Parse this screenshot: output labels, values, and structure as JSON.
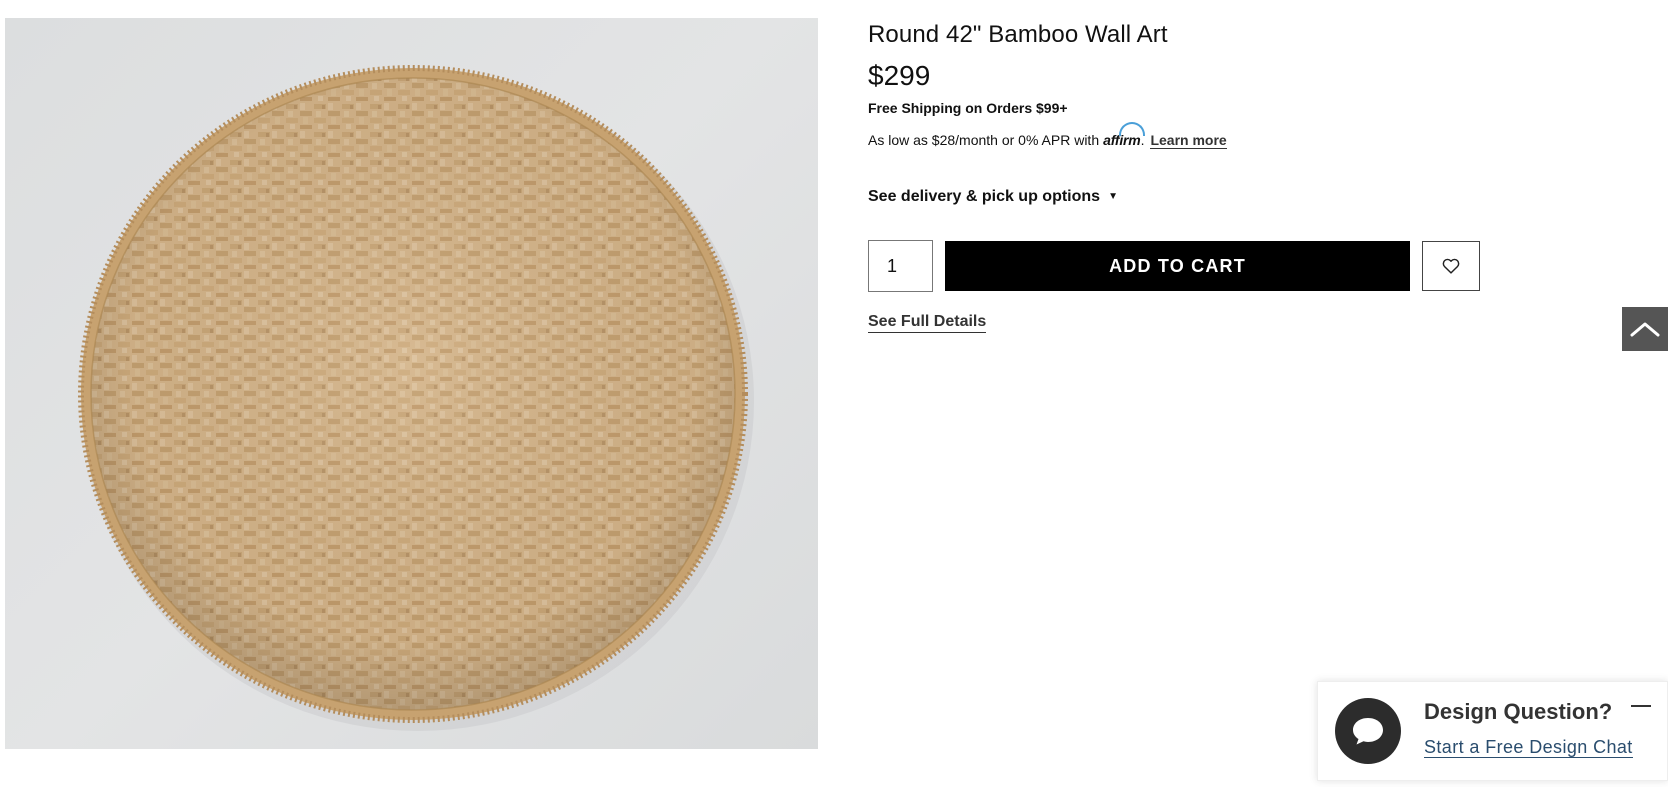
{
  "product": {
    "image_alt": "Round bamboo woven wall art",
    "title": "Round 42\" Bamboo Wall Art",
    "price": "$299",
    "shipping_note": "Free Shipping on Orders $99+",
    "financing": {
      "text": "As low as $28/month or 0% APR with",
      "provider": "affirm",
      "period": ".",
      "learn_more": "Learn more"
    },
    "delivery_label": "See delivery & pick up options",
    "delivery_caret": "▼",
    "quantity": "1",
    "add_to_cart": "ADD TO CART",
    "wishlist_icon": "heart-icon",
    "full_details": "See Full Details"
  },
  "scroll_top": {
    "icon": "chevron-up-icon"
  },
  "chat": {
    "heading": "Design Question?",
    "link": "Start a Free Design Chat",
    "icon": "chat-bubble-icon"
  },
  "colors": {
    "button_bg": "#000000",
    "scroll_top_bg": "#555555",
    "chat_link": "#2a4d6e",
    "affirm_blue": "#4a9fd8"
  }
}
